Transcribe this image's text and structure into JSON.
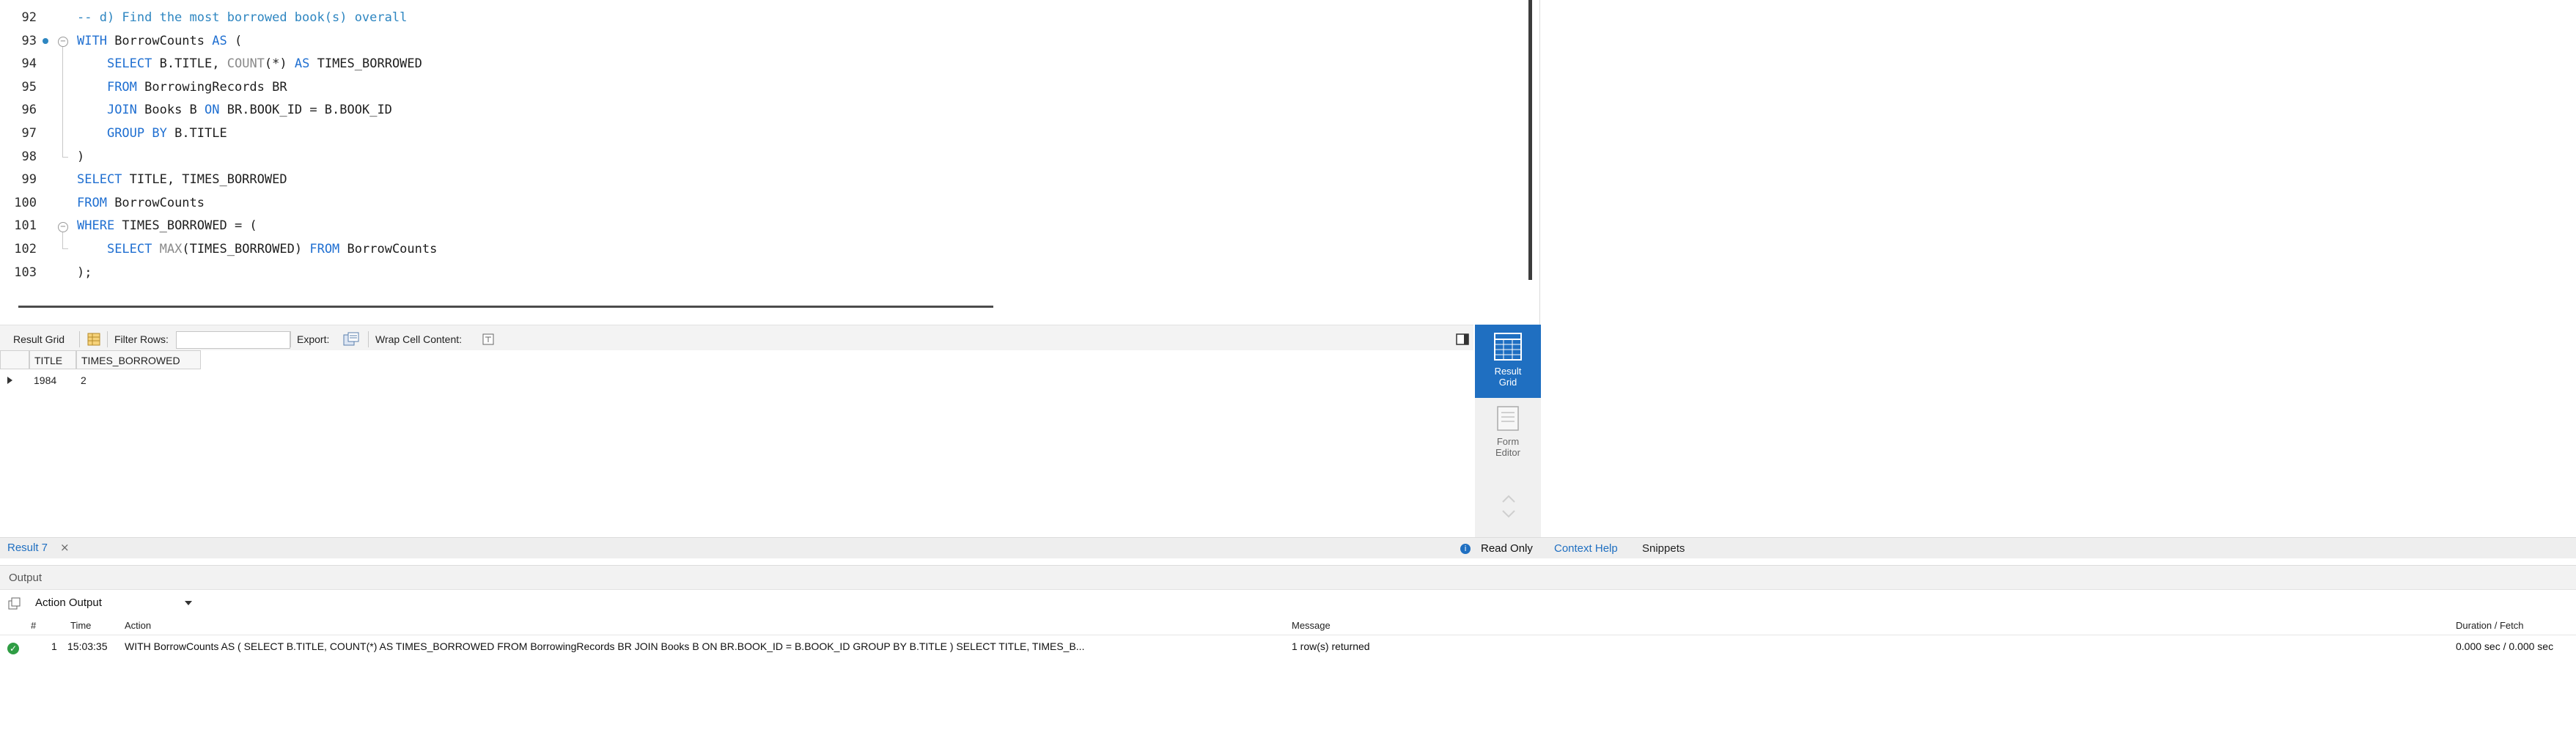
{
  "editor": {
    "lines": [
      {
        "num": "92",
        "parts": [
          [
            "cm",
            "-- d) Find the most borrowed book(s) overall"
          ]
        ]
      },
      {
        "num": "93",
        "parts": [
          [
            "kw",
            "WITH"
          ],
          [
            "",
            " BorrowCounts "
          ],
          [
            "kw",
            "AS"
          ],
          [
            "",
            " ("
          ]
        ]
      },
      {
        "num": "94",
        "parts": [
          [
            "",
            "    "
          ],
          [
            "kw",
            "SELECT"
          ],
          [
            "",
            " B.TITLE, "
          ],
          [
            "fn",
            "COUNT"
          ],
          [
            "",
            "(*) "
          ],
          [
            "kw",
            "AS"
          ],
          [
            "",
            " TIMES_BORROWED"
          ]
        ]
      },
      {
        "num": "95",
        "parts": [
          [
            "",
            "    "
          ],
          [
            "kw",
            "FROM"
          ],
          [
            "",
            " BorrowingRecords BR"
          ]
        ]
      },
      {
        "num": "96",
        "parts": [
          [
            "",
            "    "
          ],
          [
            "kw",
            "JOIN"
          ],
          [
            "",
            " Books B "
          ],
          [
            "kw",
            "ON"
          ],
          [
            "",
            " BR.BOOK_ID = B.BOOK_ID"
          ]
        ]
      },
      {
        "num": "97",
        "parts": [
          [
            "",
            "    "
          ],
          [
            "kw",
            "GROUP BY"
          ],
          [
            "",
            " B.TITLE"
          ]
        ]
      },
      {
        "num": "98",
        "parts": [
          [
            "",
            ")"
          ]
        ]
      },
      {
        "num": "99",
        "parts": [
          [
            "kw",
            "SELECT"
          ],
          [
            "",
            " TITLE, TIMES_BORROWED"
          ]
        ]
      },
      {
        "num": "100",
        "parts": [
          [
            "kw",
            "FROM"
          ],
          [
            "",
            " BorrowCounts"
          ]
        ]
      },
      {
        "num": "101",
        "parts": [
          [
            "kw",
            "WHERE"
          ],
          [
            "",
            " TIMES_BORROWED = ("
          ]
        ]
      },
      {
        "num": "102",
        "parts": [
          [
            "",
            "    "
          ],
          [
            "kw",
            "SELECT"
          ],
          [
            "",
            " "
          ],
          [
            "fn",
            "MAX"
          ],
          [
            "",
            "(TIMES_BORROWED) "
          ],
          [
            "kw",
            "FROM"
          ],
          [
            "",
            " BorrowCounts"
          ]
        ]
      },
      {
        "num": "103",
        "parts": [
          [
            "",
            ");"
          ]
        ]
      }
    ]
  },
  "result_toolbar": {
    "result_grid_label": "Result Grid",
    "filter_rows_label": "Filter Rows:",
    "filter_rows_value": "",
    "export_label": "Export:",
    "wrap_label": "Wrap Cell Content:"
  },
  "grid": {
    "columns": [
      "TITLE",
      "TIMES_BORROWED"
    ],
    "rows": [
      [
        "1984",
        "2"
      ]
    ]
  },
  "side": {
    "result_grid": "Result\nGrid",
    "form_editor": "Form\nEditor"
  },
  "tabs": {
    "result_tab": "Result 7",
    "read_only": "Read Only",
    "context_help": "Context Help",
    "snippets": "Snippets"
  },
  "output": {
    "title": "Output",
    "mode": "Action Output",
    "headers": {
      "num": "#",
      "time": "Time",
      "action": "Action",
      "message": "Message",
      "duration": "Duration / Fetch"
    },
    "rows": [
      {
        "num": "1",
        "time": "15:03:35",
        "action": "WITH BorrowCounts AS (     SELECT B.TITLE, COUNT(*) AS TIMES_BORROWED     FROM BorrowingRecords BR     JOIN Books B ON BR.BOOK_ID = B.BOOK_ID     GROUP BY B.TITLE ) SELECT TITLE, TIMES_B...",
        "message": "1 row(s) returned",
        "duration": "0.000 sec / 0.000 sec"
      }
    ]
  },
  "colors": {
    "accent": "#1f6fc1",
    "keyword": "#1f6fd1",
    "comment": "#2e86c1",
    "success": "#2f9d44"
  }
}
